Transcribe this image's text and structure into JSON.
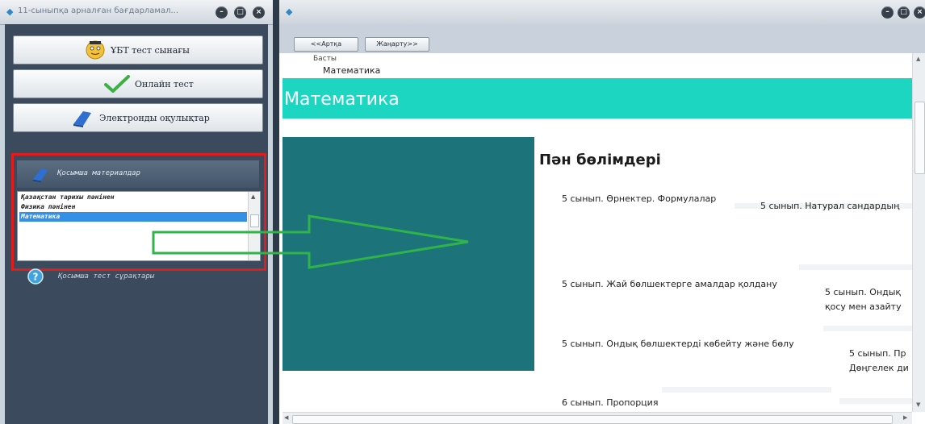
{
  "left_window": {
    "title": "11-сыныпқа арналған бағдарламал...",
    "nav_buttons": [
      "ҰБТ тест сынағы",
      "Онлайн тест",
      "Электронды оқулықтар"
    ],
    "extra_materials": {
      "header": "Қосымша материалдар",
      "items": [
        "Қазақстан тарихы пәнінен",
        "Физика пәнінен",
        "Математика"
      ],
      "selected_item": "Математика"
    },
    "extra_tests_label": "Қосымша тест сұрақтары"
  },
  "right_window": {
    "toolbar": {
      "back_label": "<<Артқа",
      "refresh_label": "Жаңарту>>"
    },
    "page": {
      "breadcrumb_top": "Басты",
      "breadcrumb_current": "Математика",
      "hero_title": "Математика",
      "sections_heading": "Пән бөлімдері",
      "topics_left": [
        "5 сынып. Өрнектер. Формулалар",
        "5 сынып. Жай бөлшектерге амалдар қолдану",
        "5 сынып. Ондық бөлшектерді көбейту және бөлу",
        "6 сынып. Пропорция"
      ],
      "topics_right": [
        "5 сынып. Натурал сандардың",
        "5 сынып. Ондық",
        "қосу мен азайту",
        "5 сынып. Пр",
        "Дөңгелек ди"
      ]
    }
  },
  "colors": {
    "highlight_border": "#e11c1c",
    "arrow": "#2fb34a",
    "hero": "#1cd6c2",
    "teal_block": "#1c7379",
    "selection": "#3490e6"
  }
}
